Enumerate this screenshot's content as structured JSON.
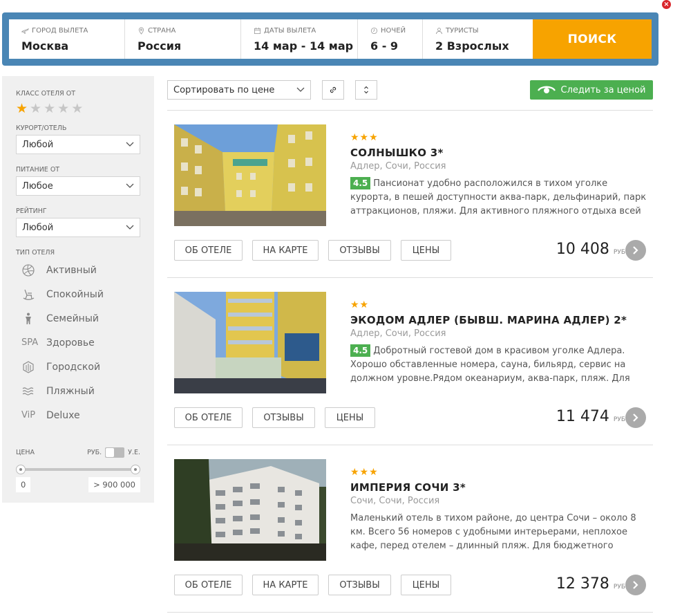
{
  "search": {
    "departure_label": "Город вылета",
    "departure_value": "Москва",
    "country_label": "Страна",
    "country_value": "Россия",
    "dates_label": "Даты вылета",
    "dates_value": "14 мар - 14 мар",
    "nights_label": "Ночей",
    "nights_value": "6 - 9",
    "tourists_label": "Туристы",
    "tourists_value": "2 Взрослых",
    "search_button": "ПОИСК"
  },
  "sidebar": {
    "hotel_class_label": "КЛАСС ОТЕЛЯ ОТ",
    "hotel_class_value": 1,
    "resort_label": "КУРОРТ/ОТЕЛЬ",
    "resort_value": "Любой",
    "meal_label": "ПИТАНИЕ ОТ",
    "meal_value": "Любое",
    "rating_label": "РЕЙТИНГ",
    "rating_value": "Любой",
    "hotel_type_label": "ТИП ОТЕЛЯ",
    "hotel_types": [
      {
        "label": "Активный",
        "icon": "volleyball-icon"
      },
      {
        "label": "Спокойный",
        "icon": "rocking-chair-icon"
      },
      {
        "label": "Семейный",
        "icon": "family-icon"
      },
      {
        "label": "Здоровье",
        "icon": "spa-icon",
        "icon_text": "SPA"
      },
      {
        "label": "Городской",
        "icon": "city-icon"
      },
      {
        "label": "Пляжный",
        "icon": "waves-icon"
      },
      {
        "label": "Deluxe",
        "icon": "vip-icon",
        "icon_text": "ViP"
      }
    ],
    "price_label": "ЦЕНА",
    "currency_rub": "РУБ.",
    "currency_ue": "У.Е.",
    "price_min": "0",
    "price_max": "> 900 000"
  },
  "toolbar": {
    "sort_value": "Сортировать по цене",
    "watch_price_label": "Следить за ценой"
  },
  "hotels": [
    {
      "stars": "★★★",
      "name": "СОЛНЫШКО 3*",
      "location": "Адлер, Сочи, Россия",
      "rating": "4.5",
      "description": "Пансионат удобно расположился в тихом уголке курорта, в пешей доступности аква-парк, дельфинарий, парк аттракционов, пляжи. Для активного пляжного отдыха всей",
      "buttons": [
        "ОБ ОТЕЛЕ",
        "НА КАРТЕ",
        "ОТЗЫВЫ",
        "ЦЕНЫ"
      ],
      "price": "10 408",
      "currency": "РУБ"
    },
    {
      "stars": "★★",
      "name": "ЭКОДОМ АДЛЕР (БЫВШ. МАРИНА АДЛЕР) 2*",
      "location": "Адлер, Сочи, Россия",
      "rating": "4.5",
      "description": "Добротный гостевой дом в красивом уголке Адлера. Хорошо обставленные номера, сауна, бильярд, сервис на должном уровне.Рядом океанариум, аква-парк, пляж. Для",
      "buttons": [
        "ОБ ОТЕЛЕ",
        "ОТЗЫВЫ",
        "ЦЕНЫ"
      ],
      "price": "11 474",
      "currency": "РУБ"
    },
    {
      "stars": "★★★",
      "name": "ИМПЕРИЯ СОЧИ 3*",
      "location": "Сочи, Сочи, Россия",
      "description": "Маленький отель в тихом районе, до центра Сочи – около 8 км. Всего 56 номеров с удобными интерьерами, неплохое кафе, перед отелем – длинный пляж. Для бюджетного отдыха",
      "buttons": [
        "ОБ ОТЕЛЕ",
        "НА КАРТЕ",
        "ОТЗЫВЫ",
        "ЦЕНЫ"
      ],
      "price": "12 378",
      "currency": "РУБ"
    }
  ]
}
